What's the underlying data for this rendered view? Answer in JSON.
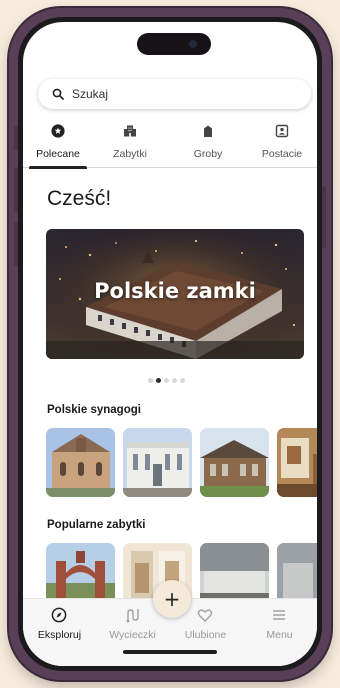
{
  "search": {
    "placeholder": "Szukaj"
  },
  "tabs": [
    {
      "label": "Polecane",
      "icon": "star-circle-icon",
      "active": true
    },
    {
      "label": "Zabytki",
      "icon": "building-icon",
      "active": false
    },
    {
      "label": "Groby",
      "icon": "tombstone-icon",
      "active": false
    },
    {
      "label": "Postacie",
      "icon": "person-badge-icon",
      "active": false
    }
  ],
  "greeting": "Cześć!",
  "carousel": {
    "title": "Polskie zamki",
    "slide_count": 5,
    "active_slide": 2
  },
  "sections": [
    {
      "title": "Polskie synagogi"
    },
    {
      "title": "Popularne zabytki"
    }
  ],
  "bottom_nav": [
    {
      "label": "Eksploruj",
      "icon": "compass-icon",
      "active": true
    },
    {
      "label": "Wycieczki",
      "icon": "route-icon",
      "active": false
    },
    {
      "label": "Ulubione",
      "icon": "heart-icon",
      "active": false
    },
    {
      "label": "Menu",
      "icon": "hamburger-menu-icon",
      "active": false
    }
  ],
  "fab": {
    "label": "+"
  },
  "colors": {
    "background": "#f6ecdd",
    "frame": "#5a3f58",
    "fab": "#f5e9da"
  }
}
